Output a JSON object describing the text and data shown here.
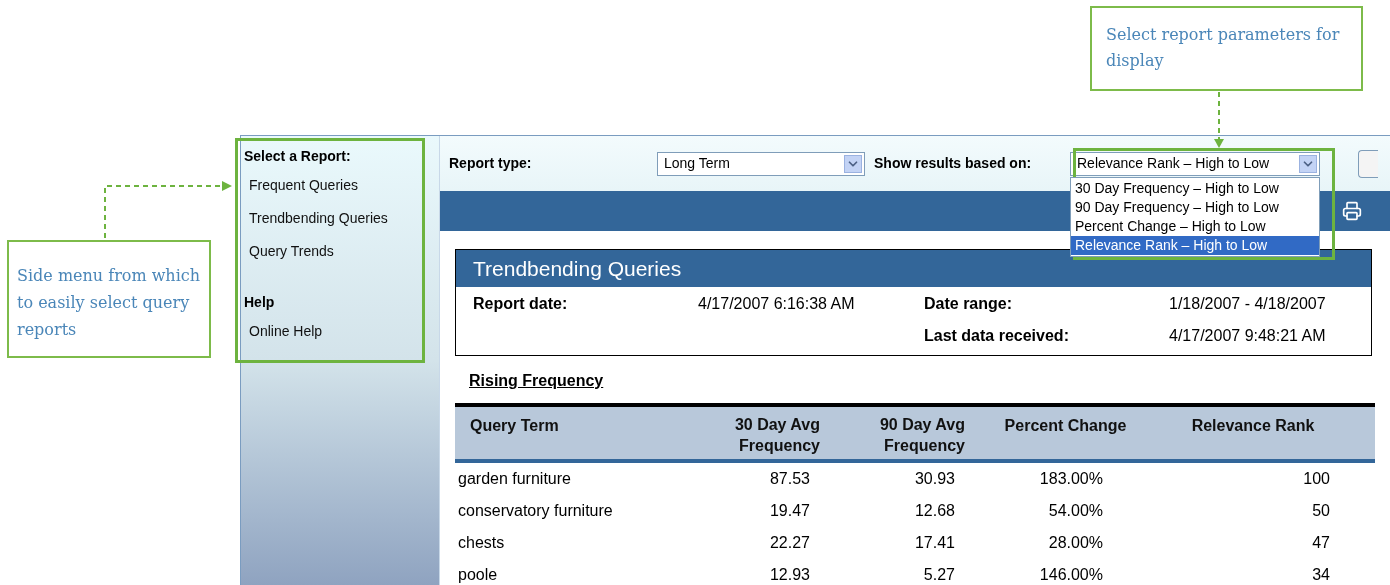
{
  "callouts": [
    {
      "text": "Side menu from which to easily select query reports"
    },
    {
      "text": "Select report parameters for display"
    }
  ],
  "sidebar": {
    "sections": [
      {
        "heading": "Select a Report:",
        "items": [
          "Frequent Queries",
          "Trendbending Queries",
          "Query Trends"
        ]
      },
      {
        "heading": "Help",
        "items": [
          "Online Help"
        ]
      }
    ]
  },
  "filters": {
    "report_type": {
      "label": "Report type:",
      "value": "Long Term"
    },
    "results_basis": {
      "label": "Show results based on:",
      "value": "Relevance Rank – High to Low",
      "options": [
        {
          "label": "30 Day Frequency – High to Low",
          "selected": false
        },
        {
          "label": "90 Day Frequency – High to Low",
          "selected": false
        },
        {
          "label": "Percent Change – High to Low",
          "selected": false
        },
        {
          "label": "Relevance Rank – High to Low",
          "selected": true
        }
      ]
    }
  },
  "report": {
    "title": "Trendbending Queries",
    "meta": [
      {
        "label": "Report date:",
        "value": "4/17/2007 6:16:38 AM"
      },
      {
        "label": "Date range:",
        "value": "1/18/2007 - 4/18/2007"
      },
      {
        "label": "Last data received:",
        "value": "4/17/2007 9:48:21 AM"
      }
    ],
    "section_title": "Rising Frequency",
    "table": {
      "columns": [
        "Query Term",
        "30 Day Avg Frequency",
        "90 Day Avg Frequency",
        "Percent Change",
        "Relevance Rank"
      ],
      "rows": [
        [
          "garden furniture",
          "87.53",
          "30.93",
          "183.00%",
          "100"
        ],
        [
          "conservatory furniture",
          "19.47",
          "12.68",
          "54.00%",
          "50"
        ],
        [
          "chests",
          "22.27",
          "17.41",
          "28.00%",
          "47"
        ],
        [
          "poole",
          "12.93",
          "5.27",
          "146.00%",
          "34"
        ]
      ]
    }
  }
}
